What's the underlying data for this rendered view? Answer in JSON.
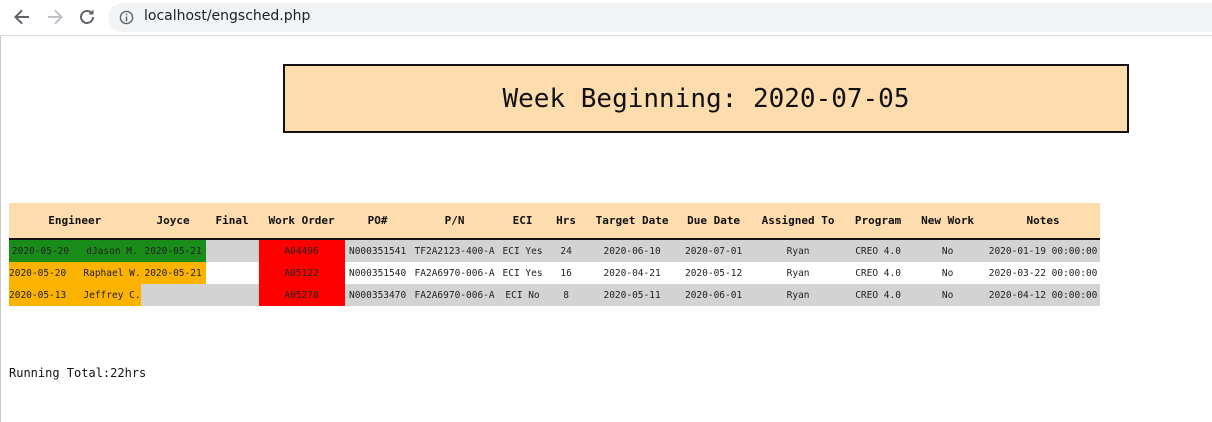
{
  "browser": {
    "url": "localhost/engsched.php",
    "icons": [
      "back-arrow-icon",
      "forward-arrow-icon",
      "reload-icon",
      "info-icon"
    ]
  },
  "header": {
    "week_label": "Week Beginning: 2020-07-05"
  },
  "table": {
    "headers": [
      "Engineer",
      "Joyce",
      "Final",
      "Work Order",
      "PO#",
      "P/N",
      "ECI",
      "Hrs",
      "Target Date",
      "Due Date",
      "Assigned To",
      "Program",
      "New Work",
      "Notes"
    ],
    "rows": [
      {
        "engineer_date": "2020-05-20",
        "engineer_name": "dJason M.",
        "joyce": "2020-05-21",
        "final": "",
        "work_order": "A04496",
        "po": "N000351541",
        "pn": "TF2A2123-400-A",
        "eci": "ECI Yes",
        "hrs": "24",
        "target_date": "2020-06-10",
        "due_date": "2020-07-01",
        "assigned_to": "Ryan",
        "program": "CREO 4.0",
        "new_work": "No",
        "notes": "2020-01-19 00:00:00"
      },
      {
        "engineer_date": "2020-05-20",
        "engineer_name": "Raphael W.",
        "joyce": "2020-05-21",
        "final": "",
        "work_order": "A05122",
        "po": "N000351540",
        "pn": "FA2A6970-006-A",
        "eci": "ECI Yes",
        "hrs": "16",
        "target_date": "2020-04-21",
        "due_date": "2020-05-12",
        "assigned_to": "Ryan",
        "program": "CREO 4.0",
        "new_work": "No",
        "notes": "2020-03-22 00:00:00"
      },
      {
        "engineer_date": "2020-05-13",
        "engineer_name": "Jeffrey C.",
        "joyce": "",
        "final": "",
        "work_order": "A05278",
        "po": "N000353470",
        "pn": "FA2A6970-006-A",
        "eci": "ECI No",
        "hrs": "8",
        "target_date": "2020-05-11",
        "due_date": "2020-06-01",
        "assigned_to": "Ryan",
        "program": "CREO 4.0",
        "new_work": "No",
        "notes": "2020-04-12 00:00:00"
      }
    ]
  },
  "footer": {
    "running_total": "Running Total:22hrs"
  },
  "colors": {
    "header_bg": "#fddcad",
    "engineer_done": "#1a8c1a",
    "engineer_pending": "#fbb300",
    "work_order": "#ff0000",
    "row_grey": "#d3d3d3"
  }
}
